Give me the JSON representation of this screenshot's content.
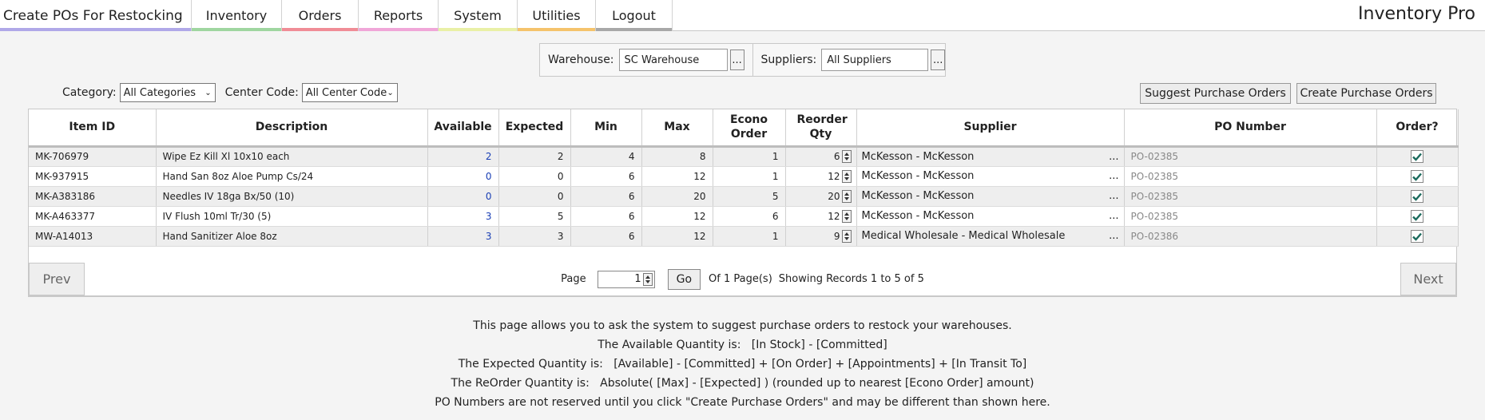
{
  "nav": {
    "title": "Create POs For Restocking",
    "items": [
      "Inventory",
      "Orders",
      "Reports",
      "System",
      "Utilities",
      "Logout"
    ],
    "brand": "Inventory Pro",
    "colors": [
      "#b0a8e8",
      "#9fd6a0",
      "#f08c96",
      "#f0a6d8",
      "#e9f0a6",
      "#f5c36b",
      "#a8a8a8"
    ]
  },
  "filters": {
    "warehouse_label": "Warehouse:",
    "warehouse_value": "SC Warehouse",
    "suppliers_label": "Suppliers:",
    "suppliers_value": "All Suppliers",
    "browse": "...",
    "category_label": "Category:",
    "category_value": "All Categories",
    "center_label": "Center Code:",
    "center_value": "All Center Code"
  },
  "actions": {
    "suggest": "Suggest Purchase Orders",
    "create": "Create Purchase Orders"
  },
  "table": {
    "headers": [
      "Item ID",
      "Description",
      "Available",
      "Expected",
      "Min",
      "Max",
      "Econo Order",
      "Reorder Qty",
      "Supplier",
      "PO Number",
      "Order?"
    ],
    "rows": [
      {
        "id": "MK-706979",
        "desc": "Wipe Ez Kill Xl 10x10 each",
        "available": "2",
        "expected": "2",
        "min": "4",
        "max": "8",
        "econo": "1",
        "reorder": "6",
        "supplier": "McKesson - McKesson",
        "po": "PO-02385"
      },
      {
        "id": "MK-937915",
        "desc": "Hand San 8oz Aloe Pump Cs/24",
        "available": "0",
        "expected": "0",
        "min": "6",
        "max": "12",
        "econo": "1",
        "reorder": "12",
        "supplier": "McKesson - McKesson",
        "po": "PO-02385"
      },
      {
        "id": "MK-A383186",
        "desc": "Needles IV 18ga Bx/50 (10)",
        "available": "0",
        "expected": "0",
        "min": "6",
        "max": "20",
        "econo": "5",
        "reorder": "20",
        "supplier": "McKesson - McKesson",
        "po": "PO-02385"
      },
      {
        "id": "MK-A463377",
        "desc": "IV Flush 10ml Tr/30 (5)",
        "available": "3",
        "expected": "5",
        "min": "6",
        "max": "12",
        "econo": "6",
        "reorder": "12",
        "supplier": "McKesson - McKesson",
        "po": "PO-02385"
      },
      {
        "id": "MW-A14013",
        "desc": "Hand Sanitizer Aloe 8oz",
        "available": "3",
        "expected": "3",
        "min": "6",
        "max": "12",
        "econo": "1",
        "reorder": "9",
        "supplier": "Medical Wholesale - Medical Wholesale",
        "po": "PO-02386"
      }
    ],
    "browse": "..."
  },
  "pager": {
    "prev": "Prev",
    "next": "Next",
    "page_label": "Page",
    "page_value": "1",
    "go": "Go",
    "of_pages": "Of 1 Page(s)",
    "showing": "Showing Records 1 to 5 of 5"
  },
  "notes": [
    "This page allows you to ask the system to suggest purchase orders to restock your warehouses.",
    "The Available Quantity is:   [In Stock] - [Committed]",
    "The Expected Quantity is:   [Available] - [Committed] + [On Order] + [Appointments] + [In Transit To]",
    "The ReOrder Quantity is:   Absolute( [Max] - [Expected] ) (rounded up to nearest [Econo Order] amount)",
    "PO Numbers are not reserved until you click \"Create Purchase Orders\" and may be different than shown here."
  ]
}
